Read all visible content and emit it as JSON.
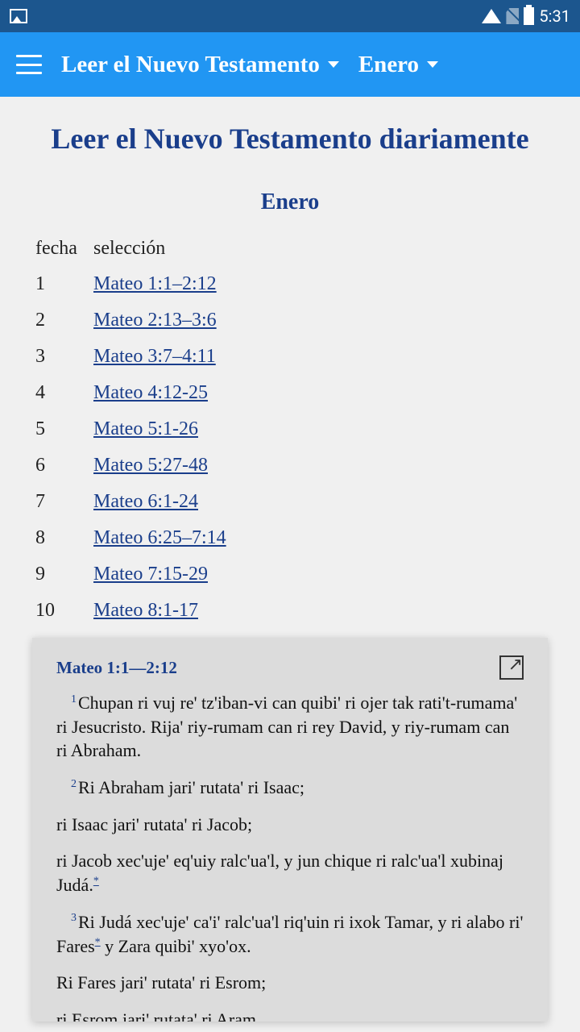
{
  "status": {
    "time": "5:31"
  },
  "appbar": {
    "dropdown1": "Leer el Nuevo Testamento",
    "dropdown2": "Enero"
  },
  "page": {
    "title": "Leer el Nuevo Testamento diariamente",
    "month": "Enero",
    "headers": {
      "date": "fecha",
      "selection": "selección"
    },
    "readings": [
      {
        "day": "1",
        "ref": "Mateo 1:1–2:12"
      },
      {
        "day": "2",
        "ref": "Mateo 2:13–3:6"
      },
      {
        "day": "3",
        "ref": "Mateo 3:7–4:11"
      },
      {
        "day": "4",
        "ref": "Mateo 4:12-25"
      },
      {
        "day": "5",
        "ref": "Mateo 5:1-26"
      },
      {
        "day": "6",
        "ref": "Mateo 5:27-48"
      },
      {
        "day": "7",
        "ref": "Mateo 6:1-24"
      },
      {
        "day": "8",
        "ref": "Mateo 6:25–7:14"
      },
      {
        "day": "9",
        "ref": "Mateo 7:15-29"
      },
      {
        "day": "10",
        "ref": "Mateo 8:1-17"
      }
    ]
  },
  "overlay": {
    "title": "Mateo 1:1—2:12",
    "v1num": "1",
    "v1": "Chupan ri vuj re' tz'iban-vi can quibi' ri ojer tak rati't-rumama' ri Jesucristo. Rija' riy-rumam can ri rey David, y riy-rumam can ri Abraham.",
    "v2num": "2",
    "v2a": "Ri Abraham jari' rutata' ri Isaac;",
    "v2b": "ri Isaac jari' rutata' ri Jacob;",
    "v2c": "ri Jacob xec'uje' eq'uiy ralc'ua'l, y jun chique ri ralc'ua'l xubinaj Judá.",
    "fn1": "*",
    "v3num": "3",
    "v3a_pre": "Ri Judá xec'uje' ca'i' ralc'ua'l riq'uin ri ixok Tamar, y ri alabo ri' Fares",
    "fn2": "*",
    "v3a_post": " y Zara quibi' xyo'ox.",
    "v3b": "Ri Fares jari' rutata' ri Esrom;",
    "v3c": "ri Esrom jari' rutata' ri Aram"
  }
}
